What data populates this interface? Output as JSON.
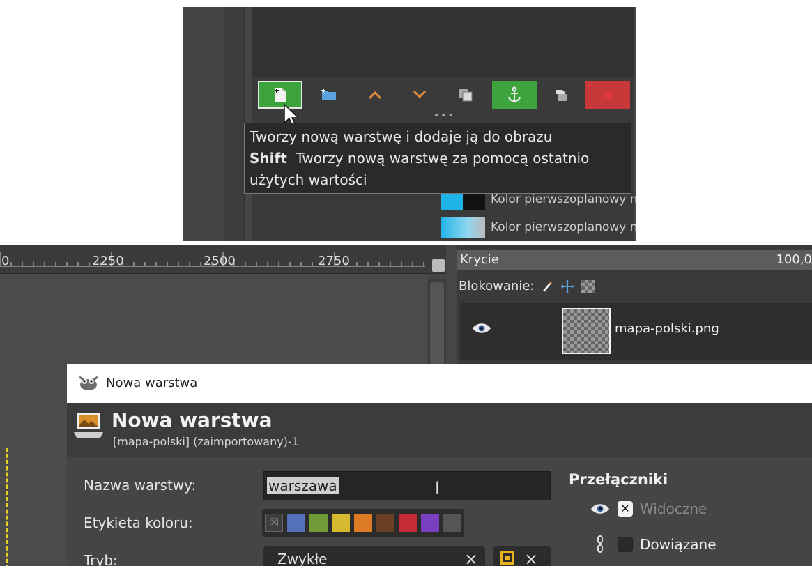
{
  "top": {
    "toolbar": {
      "colors": {
        "green": "#3ca33d",
        "red": "#c8373a",
        "blue_icon": "#5aa3e0",
        "orange_icon": "#e08a3c"
      }
    },
    "tooltip": {
      "line1": "Tworzy nową warstwę i dodaje ją do obrazu",
      "line2_key": "Shift",
      "line2_rest": "Tworzy nową warstwę za pomocą ostatnio",
      "line3": "użytych wartości"
    },
    "gradients": [
      {
        "label": "Kolor pierwszoplanowy na kolor tła (twarda kr"
      },
      {
        "label": "Kolor pierwszoplanowy na przezroczystość"
      }
    ]
  },
  "ruler": {
    "labels": [
      "0",
      "2250",
      "2500",
      "2750"
    ]
  },
  "layers_panel": {
    "opacity_label": "Krycie",
    "opacity_value": "100,0",
    "lock_label": "Blokowanie:",
    "layer_name": "mapa-polski.png"
  },
  "dialog": {
    "window_title": "Nowa warstwa",
    "header_title": "Nowa warstwa",
    "header_subtitle": "[mapa-polski] (zaimportowany)-1",
    "name_label": "Nazwa warstwy:",
    "name_value": "warszawa",
    "color_tag_label": "Etykieta koloru:",
    "color_tags": [
      "#5470b8",
      "#6f9a35",
      "#d6b92e",
      "#dd7b24",
      "#6a4022",
      "#c42b36",
      "#7a3fc1",
      "#555555"
    ],
    "mode_label": "Tryb:",
    "mode_value": "Zwykłe",
    "switches_title": "Przełączniki",
    "switch_visible": "Widoczne",
    "switch_linked": "Dowiązane"
  }
}
